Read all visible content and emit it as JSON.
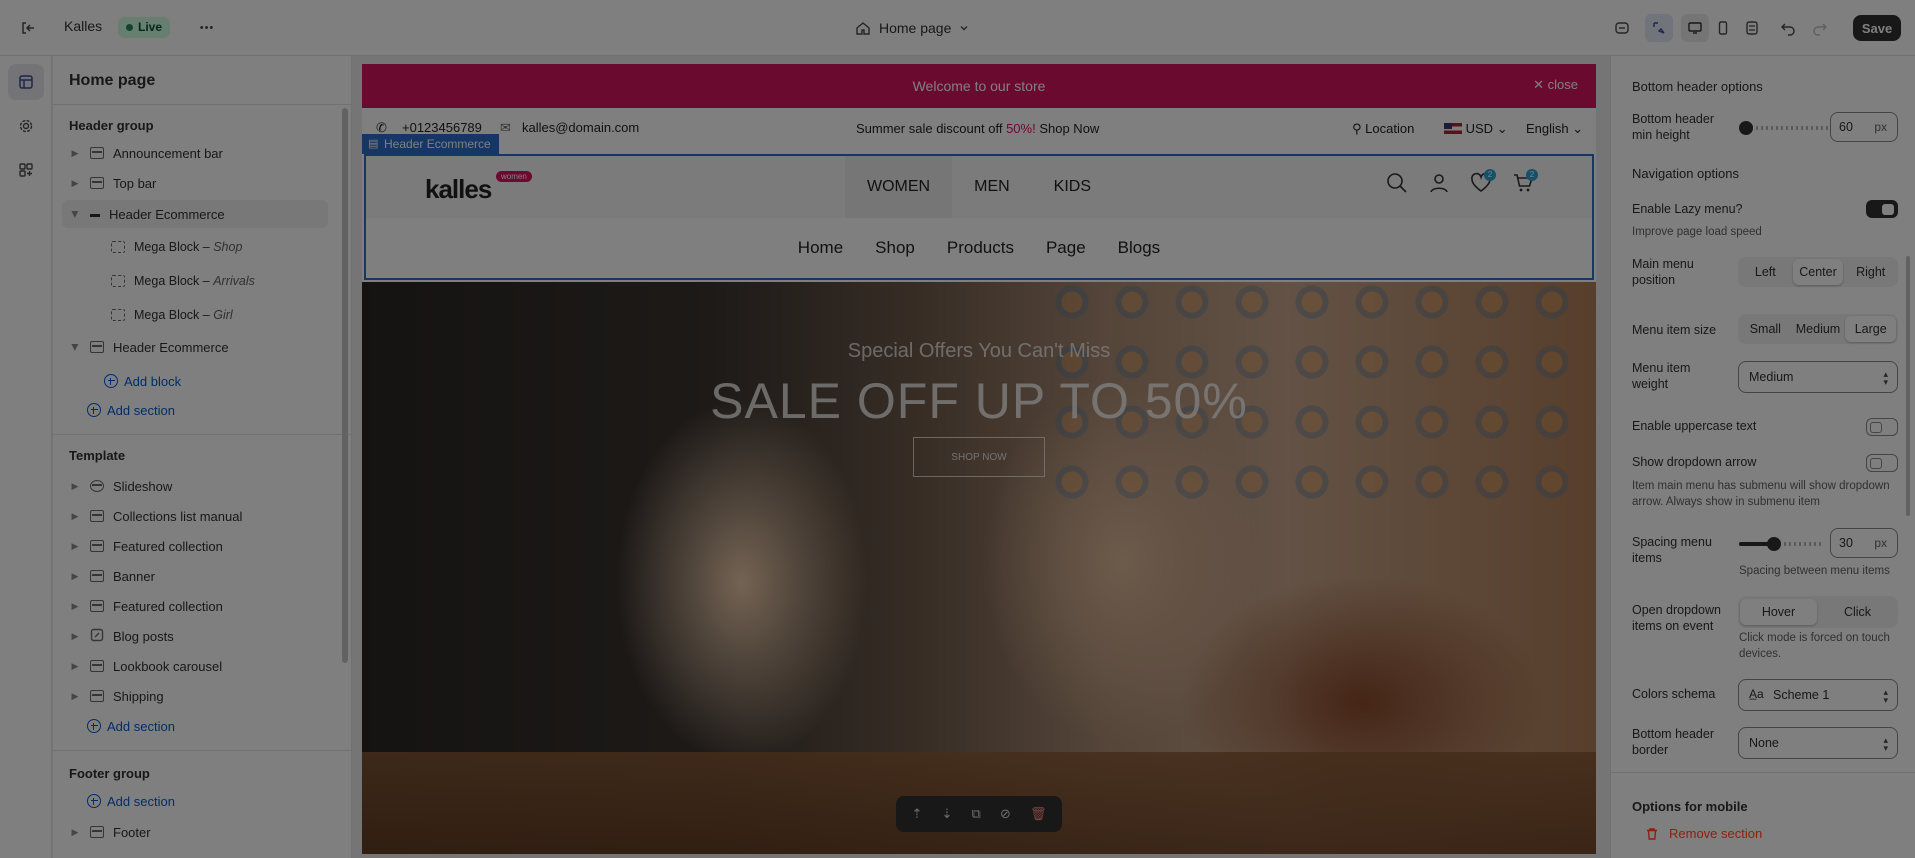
{
  "topbar": {
    "store_name": "Kalles",
    "status_badge": "Live",
    "more_label": "•••",
    "page_selector": "Home page",
    "save_label": "Save"
  },
  "left_panel": {
    "title": "Home page",
    "header_group": {
      "label": "Header group",
      "items": [
        {
          "label": "Announcement bar"
        },
        {
          "label": "Top bar"
        },
        {
          "label": "Header Ecommerce",
          "selected": true
        }
      ],
      "sub_blocks": [
        {
          "name": "Mega Block",
          "variant": "Shop"
        },
        {
          "name": "Mega Block",
          "variant": "Arrivals"
        },
        {
          "name": "Mega Block",
          "variant": "Girl"
        }
      ],
      "second_header": "Header Ecommerce",
      "add_block": "Add block",
      "add_section": "Add section"
    },
    "template": {
      "label": "Template",
      "items": [
        {
          "label": "Slideshow"
        },
        {
          "label": "Collections list manual"
        },
        {
          "label": "Featured collection"
        },
        {
          "label": "Banner"
        },
        {
          "label": "Featured collection"
        },
        {
          "label": "Blog posts"
        },
        {
          "label": "Lookbook carousel"
        },
        {
          "label": "Shipping"
        }
      ],
      "add_section": "Add section"
    },
    "footer_group": {
      "label": "Footer group",
      "add_section": "Add section",
      "items": [
        {
          "label": "Footer"
        }
      ]
    }
  },
  "preview": {
    "announcement": {
      "text": "Welcome to our store",
      "close": "close"
    },
    "topstrip": {
      "phone": "+0123456789",
      "email": "kalles@domain.com",
      "promo_prefix": "Summer sale discount off ",
      "promo_percent": "50%!",
      "promo_link": "Shop Now",
      "location": "Location",
      "currency": "USD",
      "language": "English"
    },
    "selection_label": "Header Ecommerce",
    "logo": "kalles",
    "logo_tag": "women",
    "main_nav": [
      "WOMEN",
      "MEN",
      "KIDS"
    ],
    "wishlist_count": "2",
    "cart_count": "2",
    "bottom_nav": [
      "Home",
      "Shop",
      "Products",
      "Page",
      "Blogs"
    ],
    "hero": {
      "subtitle": "Special Offers You Can't Miss",
      "title": "SALE OFF UP TO 50%",
      "button": "SHOP NOW"
    }
  },
  "settings": {
    "bottom_header_options": "Bottom header options",
    "min_height_label": "Bottom header min height",
    "min_height_value": "60",
    "min_height_unit": "px",
    "min_height_fraction": 0.0,
    "navigation_options": "Navigation options",
    "lazy_menu_label": "Enable Lazy menu?",
    "lazy_menu_help": "Improve page load speed",
    "lazy_menu_on": true,
    "menu_position_label": "Main menu position",
    "menu_position_options": [
      "Left",
      "Center",
      "Right"
    ],
    "menu_position_selected": "Center",
    "menu_item_size_label": "Menu item size",
    "menu_item_size_options": [
      "Small",
      "Medium",
      "Large"
    ],
    "menu_item_size_selected": "Large",
    "menu_item_weight_label": "Menu item weight",
    "menu_item_weight_value": "Medium",
    "uppercase_label": "Enable uppercase text",
    "uppercase_on": false,
    "dropdown_arrow_label": "Show dropdown arrow",
    "dropdown_arrow_on": false,
    "dropdown_arrow_help": "Item main menu has submenu will show dropdown arrow. Always show in submenu item",
    "spacing_label": "Spacing menu items",
    "spacing_value": "30",
    "spacing_unit": "px",
    "spacing_fraction": 0.42,
    "spacing_help": "Spacing between menu items",
    "open_dropdown_label": "Open dropdown items on event",
    "open_dropdown_options": [
      "Hover",
      "Click"
    ],
    "open_dropdown_selected": "Hover",
    "open_dropdown_help": "Click mode is forced on touch devices.",
    "colors_schema_label": "Colors schema",
    "colors_schema_value": "Scheme 1",
    "border_label": "Bottom header border",
    "border_value": "None",
    "options_mobile": "Options for mobile",
    "remove_section": "Remove section"
  }
}
